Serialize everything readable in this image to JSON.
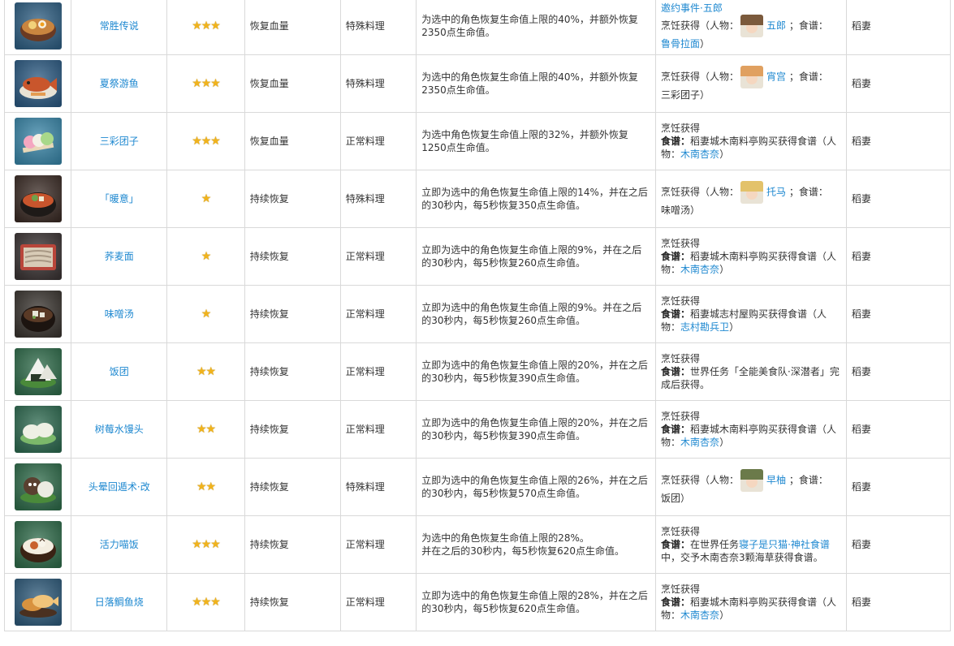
{
  "rows": [
    {
      "thumb_icon": "ramen-bowl-icon",
      "thumb_colors": [
        "#2f5f83",
        "#c9853f",
        "#f2d27a"
      ],
      "name": "常胜传说",
      "stars": "★★★",
      "type": "恢复血量",
      "category": "特殊料理",
      "desc": "为选中的角色恢复生命值上限的40%，并额外恢复2350点生命值。",
      "src_top_link": "邀约事件·五郎",
      "src_pre": "烹饪获得（人物：",
      "src_char": "五郎",
      "avatar_colors": [
        "#7b5a3c",
        "#f5d7c0"
      ],
      "src_mid": "；食谱：",
      "src_dish": "鲁骨拉面",
      "src_dish_link": true,
      "src_end": "）",
      "region": "稻妻"
    },
    {
      "thumb_icon": "grilled-fish-icon",
      "thumb_colors": [
        "#2c5a82",
        "#c9562c",
        "#e39c52"
      ],
      "name": "夏祭游鱼",
      "stars": "★★★",
      "type": "恢复血量",
      "category": "特殊料理",
      "desc": "为选中的角色恢复生命值上限的40%，并额外恢复2350点生命值。",
      "src_pre": "烹饪获得（人物：",
      "src_char": "宵宫",
      "avatar_colors": [
        "#e0a060",
        "#f5d7c0"
      ],
      "src_mid": "；食谱：",
      "src_dish": "三彩团子",
      "src_dish_link": false,
      "src_end": "）",
      "region": "稻妻"
    },
    {
      "thumb_icon": "dango-icon",
      "thumb_colors": [
        "#3a86a8",
        "#f4a7c0",
        "#a8d88a"
      ],
      "name": "三彩团子",
      "stars": "★★★",
      "type": "恢复血量",
      "category": "正常料理",
      "desc": "为选中角色恢复生命值上限的32%，并额外恢复1250点生命值。",
      "src_title": "烹饪获得",
      "src_recipe_label": "食谱：",
      "src_recipe_text": "稻妻城木南料亭购买获得食谱（人物：",
      "src_recipe_link": "木南杏奈",
      "src_recipe_end": "）",
      "region": "稻妻"
    },
    {
      "thumb_icon": "miso-bowl-icon",
      "thumb_colors": [
        "#3b2c26",
        "#c8552d",
        "#6fa24c"
      ],
      "name": "「暖意」",
      "stars": "★",
      "type": "持续恢复",
      "category": "特殊料理",
      "desc": "立即为选中的角色恢复生命值上限的14%，并在之后的30秒内，每5秒恢复350点生命值。",
      "src_pre": "烹饪获得（人物：",
      "src_char": "托马",
      "avatar_colors": [
        "#e3c26a",
        "#f5d7c0"
      ],
      "src_mid": "；食谱：",
      "src_dish": "味噌汤",
      "src_dish_link": false,
      "src_end": "）",
      "region": "稻妻"
    },
    {
      "thumb_icon": "soba-tray-icon",
      "thumb_colors": [
        "#3b3434",
        "#b9463a",
        "#d8cbb6"
      ],
      "name": "荞麦面",
      "stars": "★",
      "type": "持续恢复",
      "category": "正常料理",
      "desc": "立即为选中的角色恢复生命值上限的9%，并在之后的30秒内，每5秒恢复260点生命值。",
      "src_title": "烹饪获得",
      "src_recipe_label": "食谱：",
      "src_recipe_text": "稻妻城木南料亭购买获得食谱（人物：",
      "src_recipe_link": "木南杏奈",
      "src_recipe_end": "）",
      "region": "稻妻"
    },
    {
      "thumb_icon": "miso-soup-icon",
      "thumb_colors": [
        "#3a3530",
        "#5a3a26",
        "#e8e6d8"
      ],
      "name": "味噌汤",
      "stars": "★",
      "type": "持续恢复",
      "category": "正常料理",
      "desc": "立即为选中的角色恢复生命值上限的9%。并在之后的30秒内，每5秒恢复260点生命值。",
      "src_title": "烹饪获得",
      "src_recipe_label": "食谱：",
      "src_recipe_text": "稻妻城志村屋购买获得食谱（人物：",
      "src_recipe_link": "志村勘兵卫",
      "src_recipe_end": "）",
      "region": "稻妻"
    },
    {
      "thumb_icon": "onigiri-icon",
      "thumb_colors": [
        "#2f6b4a",
        "#f2f2ee",
        "#2a3a2a"
      ],
      "name": "饭团",
      "stars": "★★",
      "type": "持续恢复",
      "category": "正常料理",
      "desc": "立即为选中的角色恢复生命值上限的20%，并在之后的30秒内，每5秒恢复390点生命值。",
      "src_title": "烹饪获得",
      "src_recipe_label": "食谱：",
      "src_recipe_text": "世界任务「全能美食队·深潜者」完成后获得。",
      "src_recipe_link": "",
      "src_recipe_end": "",
      "region": "稻妻"
    },
    {
      "thumb_icon": "mochi-bun-icon",
      "thumb_colors": [
        "#2e6a50",
        "#eef0e4",
        "#7bb86a"
      ],
      "name": "树莓水馒头",
      "stars": "★★",
      "type": "持续恢复",
      "category": "正常料理",
      "desc": "立即为选中的角色恢复生命值上限的20%，并在之后的30秒内，每5秒恢复390点生命值。",
      "src_title": "烹饪获得",
      "src_recipe_label": "食谱：",
      "src_recipe_text": "稻妻城木南料亭购买获得食谱（人物：",
      "src_recipe_link": "木南杏奈",
      "src_recipe_end": "）",
      "region": "稻妻"
    },
    {
      "thumb_icon": "tanuki-onigiri-icon",
      "thumb_colors": [
        "#2f6b4a",
        "#5a4030",
        "#ecebe2"
      ],
      "name": "头晕回遁术·改",
      "stars": "★★",
      "type": "持续恢复",
      "category": "特殊料理",
      "desc": "立即为选中的角色恢复生命值上限的26%，并在之后的30秒内，每5秒恢复570点生命值。",
      "src_pre": "烹饪获得（人物：",
      "src_char": "早柚",
      "avatar_colors": [
        "#6b7a4a",
        "#f5d7c0"
      ],
      "src_mid": "；食谱：",
      "src_dish": "饭团",
      "src_dish_link": false,
      "src_end": "）",
      "region": "稻妻"
    },
    {
      "thumb_icon": "rice-bowl-icon",
      "thumb_colors": [
        "#2f6b4a",
        "#c8602c",
        "#f3ede0"
      ],
      "name": "活力喵饭",
      "stars": "★★★",
      "type": "持续恢复",
      "category": "正常料理",
      "desc_line1": "为选中的角色恢复生命值上限的28%。",
      "desc_line2": "并在之后的30秒内，每5秒恢复620点生命值。",
      "src_title": "烹饪获得",
      "src_recipe_label": "食谱：",
      "src_recipe_text": "在世界任务",
      "src_recipe_link": "寝子是只猫·神社食谱",
      "src_recipe_end": "中，交予木南杏奈3颗海草获得食谱。",
      "region": "稻妻"
    },
    {
      "thumb_icon": "taiyaki-icon",
      "thumb_colors": [
        "#2e5a7a",
        "#d8923e",
        "#f1c47a"
      ],
      "name": "日落鲷鱼烧",
      "stars": "★★★",
      "type": "持续恢复",
      "category": "正常料理",
      "desc": "立即为选中的角色恢复生命值上限的28%，并在之后的30秒内，每5秒恢复620点生命值。",
      "src_title": "烹饪获得",
      "src_recipe_label": "食谱：",
      "src_recipe_text": "稻妻城木南料亭购买获得食谱（人物：",
      "src_recipe_link": "木南杏奈",
      "src_recipe_end": "）",
      "region": "稻妻"
    }
  ]
}
